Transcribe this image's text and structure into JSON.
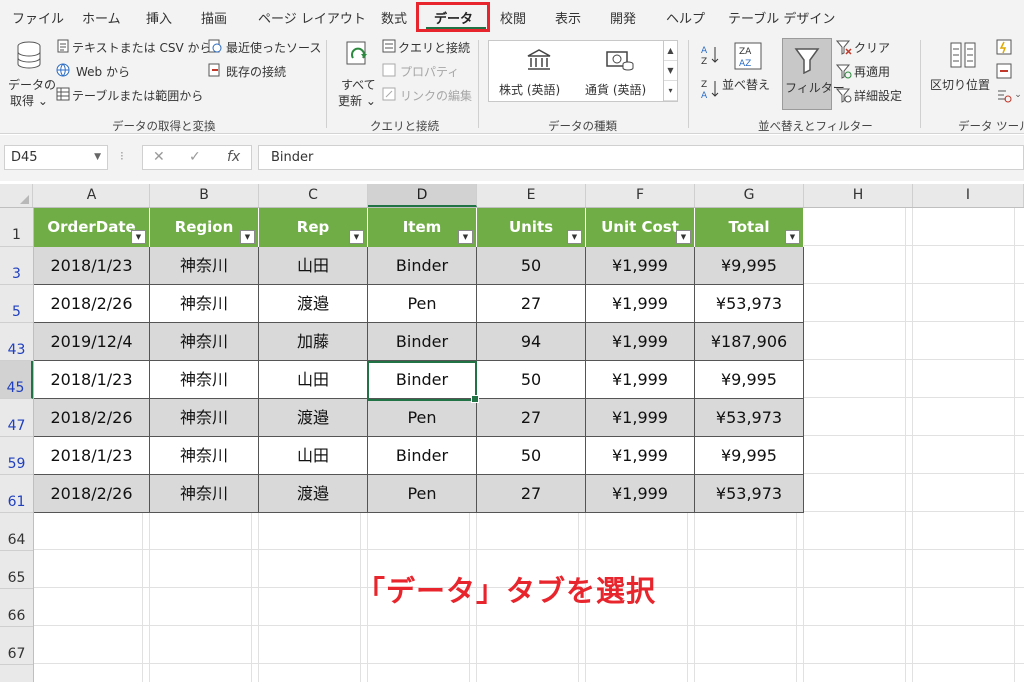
{
  "ribbon_tabs": [
    "ファイル",
    "ホーム",
    "挿入",
    "描画",
    "ページ レイアウト",
    "数式",
    "データ",
    "校閲",
    "表示",
    "開発",
    "ヘルプ",
    "テーブル デザイン"
  ],
  "active_tab": "データ",
  "ribbon": {
    "get_data": {
      "label1": "データの",
      "label2": "取得 ⌄"
    },
    "from_text_csv": "テキストまたは CSV から",
    "from_web": "Web から",
    "from_table": "テーブルまたは範囲から",
    "recent_sources": "最近使ったソース",
    "existing_connections": "既存の接続",
    "group_get_transform": "データの取得と変換",
    "refresh_all": {
      "label1": "すべて",
      "label2": "更新 ⌄"
    },
    "queries_connections": "クエリと接続",
    "properties": "プロパティ",
    "edit_links": "リンクの編集",
    "group_queries": "クエリと接続",
    "stocks": "株式 (英語)",
    "currencies": "通貨 (英語)",
    "group_data_types": "データの種類",
    "sort": "並べ替え",
    "filter": "フィルター",
    "clear": "クリア",
    "reapply": "再適用",
    "advanced": "詳細設定",
    "group_sort_filter": "並べ替えとフィルター",
    "text_to_columns": "区切り位置",
    "group_data_tools": "データ ツール"
  },
  "formula_bar": {
    "name_box": "D45",
    "fx": "fx",
    "value": "Binder"
  },
  "columns": [
    "A",
    "B",
    "C",
    "D",
    "E",
    "F",
    "G",
    "H",
    "I"
  ],
  "header_row_num": "1",
  "table_headers": [
    "OrderDate",
    "Region",
    "Rep",
    "Item",
    "Units",
    "Unit Cost",
    "Total"
  ],
  "rows": [
    {
      "num": "3",
      "cells": [
        "2018/1/23",
        "神奈川",
        "山田",
        "Binder",
        "50",
        "¥1,999",
        "¥9,995"
      ]
    },
    {
      "num": "5",
      "cells": [
        "2018/2/26",
        "神奈川",
        "渡邉",
        "Pen",
        "27",
        "¥1,999",
        "¥53,973"
      ]
    },
    {
      "num": "43",
      "cells": [
        "2019/12/4",
        "神奈川",
        "加藤",
        "Binder",
        "94",
        "¥1,999",
        "¥187,906"
      ]
    },
    {
      "num": "45",
      "cells": [
        "2018/1/23",
        "神奈川",
        "山田",
        "Binder",
        "50",
        "¥1,999",
        "¥9,995"
      ]
    },
    {
      "num": "47",
      "cells": [
        "2018/2/26",
        "神奈川",
        "渡邉",
        "Pen",
        "27",
        "¥1,999",
        "¥53,973"
      ]
    },
    {
      "num": "59",
      "cells": [
        "2018/1/23",
        "神奈川",
        "山田",
        "Binder",
        "50",
        "¥1,999",
        "¥9,995"
      ]
    },
    {
      "num": "61",
      "cells": [
        "2018/2/26",
        "神奈川",
        "渡邉",
        "Pen",
        "27",
        "¥1,999",
        "¥53,973"
      ]
    }
  ],
  "empty_rows": [
    "64",
    "65",
    "66",
    "67"
  ],
  "annotation": "「データ」タブを選択",
  "colors": {
    "accent": "#217346",
    "table_header": "#70ad47",
    "highlight": "#e8252c",
    "row_grey": "#d9d9d9"
  }
}
